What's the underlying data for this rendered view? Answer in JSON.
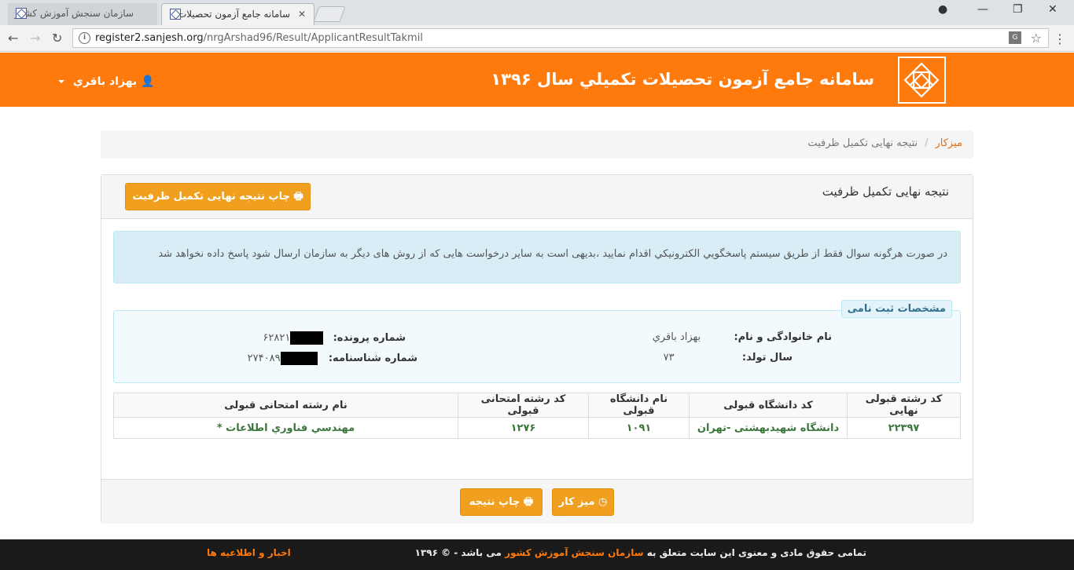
{
  "browser": {
    "tabs": [
      {
        "title": "سازمان سنجش آموزش کشور",
        "active": false
      },
      {
        "title": "سامانه جامع آزمون تحصیلات",
        "active": true
      }
    ],
    "url_domain": "register2.sanjesh.org",
    "url_path": "/nrgArshad96/Result/ApplicantResultTakmil"
  },
  "header": {
    "title": "سامانه جامع آزمون تحصيلات تكميلي سال ۱۳۹۶",
    "user_name": "بهزاد باقري"
  },
  "breadcrumb": {
    "home": "ميزكار",
    "current": "نتیجه نهایی تکمیل ظرفیت"
  },
  "panel": {
    "title": "نتیجه نهایی تکمیل ظرفیت",
    "print_final_label": "چاپ نتیجه نهایی تکمیل ظرفیت"
  },
  "alert": {
    "text": "در صورت هرگونه سوال فقط از طريق سيستم پاسخگويي الكترونيكي اقدام نماييد ،بديهی است به ساير درخواست هايی که از روش های ديگر به سازمان ارسال شود پاسخ داده نخواهد شد"
  },
  "registration": {
    "legend": "مشخصات ثبت نامی",
    "name_label": "نام خانوادگی و نام:",
    "name_value": "بهزاد باقري",
    "birth_label": "سال تولد:",
    "birth_value": "۷۳",
    "file_label": "شماره پرونده:",
    "file_value_suffix": "۶۲۸۲۱",
    "id_label": "شماره شناسنامه:",
    "id_value_suffix": "۲۷۴۰۸۹"
  },
  "result_table": {
    "headers": [
      "کد رشته قبولی نهایی",
      "کد دانشگاه قبولی",
      "نام دانشگاه قبولی",
      "کد رشته امتحانی قبولی",
      "نام رشته امتحانی قبولی"
    ],
    "rows": [
      [
        "۲۲۳۹۷",
        "دانشگاه شهیدبهشتی -تهران",
        "۱۰۹۱",
        "۱۲۷۶",
        "مهندسي فناوري اطلاعات *"
      ]
    ]
  },
  "footer_buttons": {
    "desk_label": "ميز كار",
    "print_label": "چاپ نتيجه"
  },
  "footer": {
    "copy_prefix": "تمامی حقوق مادی و معنوی این سایت متعلق به",
    "copy_org": "سازمان سنجش آموزش کشور",
    "copy_suffix": "می باشد - © ۱۳۹۶",
    "news": "اخبار و اطلاعیه ها"
  }
}
